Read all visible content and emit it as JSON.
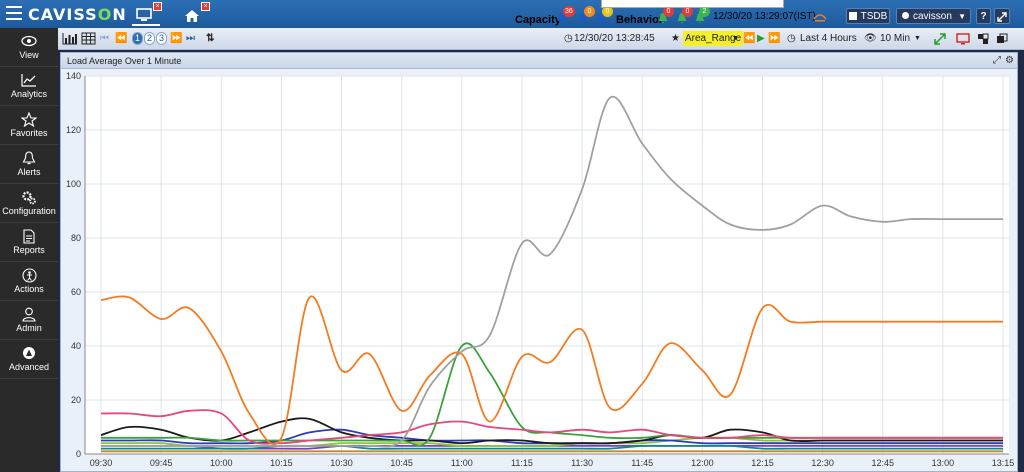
{
  "app": {
    "logo_left": "CAVISS",
    "logo_o": "O",
    "logo_right": "N"
  },
  "header": {
    "capacity_label": "Capacity",
    "capacity_badges": [
      "36",
      "0",
      "0"
    ],
    "behavior_label": "Behavior",
    "behavior_badges": [
      "0",
      "0",
      "2"
    ],
    "timestamp": "12/30/20 13:29:07(IST)",
    "tsdb_label": "TSDB",
    "user_label": "cavisson",
    "help_label": "?",
    "badge_colors": {
      "critical": "#e23b3b",
      "major": "#f08a1c",
      "minor": "#e6c417",
      "ok": "#3fb34f"
    }
  },
  "sidebar": {
    "items": [
      {
        "label": "View",
        "icon": "eye-icon"
      },
      {
        "label": "Analytics",
        "icon": "chart-line-icon"
      },
      {
        "label": "Favorites",
        "icon": "star-icon"
      },
      {
        "label": "Alerts",
        "icon": "bell-icon"
      },
      {
        "label": "Configuration",
        "icon": "cogs-icon"
      },
      {
        "label": "Reports",
        "icon": "document-icon"
      },
      {
        "label": "Actions",
        "icon": "actions-icon"
      },
      {
        "label": "Admin",
        "icon": "user-icon"
      },
      {
        "label": "Advanced",
        "icon": "advanced-icon"
      }
    ]
  },
  "toolbar": {
    "pages": [
      "1",
      "2",
      "3"
    ],
    "current_page": "1",
    "time": "12/30/20 13:28:45",
    "area_range": "Area_Range",
    "duration": "Last 4 Hours",
    "interval": "10 Min"
  },
  "panel": {
    "title": "Load Average Over 1 Minute"
  },
  "chart_data": {
    "type": "line",
    "title": "Load Average Over 1 Minute",
    "xlabel": "",
    "ylabel": "",
    "ylim": [
      0,
      140
    ],
    "yticks": [
      0,
      20,
      40,
      60,
      80,
      100,
      120,
      140
    ],
    "grid": true,
    "categories": [
      "09:30",
      "09:45",
      "10:00",
      "10:15",
      "10:30",
      "10:45",
      "11:00",
      "11:15",
      "11:30",
      "11:45",
      "12:00",
      "12:15",
      "12:30",
      "12:45",
      "13:00",
      "13:15"
    ],
    "x_minutes": [
      0,
      7,
      15,
      22,
      30,
      37,
      45,
      52,
      60,
      67,
      75,
      82,
      90,
      97,
      105,
      112,
      120,
      127,
      135,
      142,
      150,
      157,
      165,
      172,
      180,
      187,
      195,
      202,
      210,
      217,
      225
    ],
    "series": [
      {
        "color": "#a0a0a0",
        "values": [
          3,
          3,
          3,
          3,
          3,
          3,
          3,
          3,
          3,
          3,
          5,
          25,
          38,
          44,
          78,
          74,
          98,
          132,
          115,
          102,
          92,
          85,
          83,
          85,
          92,
          88,
          86,
          87,
          87,
          87,
          87
        ]
      },
      {
        "color": "#f47b20",
        "values": [
          57,
          58,
          50,
          54,
          38,
          15,
          6,
          58,
          31,
          37,
          16,
          29,
          37,
          12,
          36,
          34,
          46,
          17,
          26,
          41,
          31,
          22,
          54,
          49,
          49,
          49,
          49,
          49,
          49,
          49,
          49
        ]
      },
      {
        "color": "#e8467c",
        "values": [
          15,
          15,
          14,
          16,
          15,
          5,
          4,
          5,
          6,
          7,
          8,
          11,
          12,
          10,
          9,
          8,
          9,
          8,
          9,
          7,
          6,
          6,
          7,
          6,
          6,
          6,
          6,
          6,
          6,
          6,
          6
        ]
      },
      {
        "color": "#3aa23a",
        "values": [
          6,
          6,
          6,
          6,
          5,
          5,
          5,
          5,
          5,
          5,
          5,
          6,
          40,
          30,
          10,
          8,
          7,
          6,
          6,
          7,
          6,
          6,
          6,
          6,
          6,
          6,
          6,
          6,
          6,
          6,
          6
        ]
      },
      {
        "color": "#1a1a1a",
        "values": [
          7,
          10,
          9,
          6,
          5,
          8,
          12,
          13,
          8,
          6,
          5,
          5,
          4,
          5,
          5,
          4,
          4,
          4,
          5,
          7,
          6,
          9,
          8,
          5,
          5,
          5,
          5,
          5,
          5,
          5,
          5
        ]
      },
      {
        "color": "#2b3bbd",
        "values": [
          5,
          5,
          5,
          4,
          4,
          4,
          5,
          8,
          9,
          7,
          6,
          5,
          5,
          5,
          4,
          4,
          4,
          4,
          5,
          5,
          4,
          4,
          4,
          4,
          4,
          4,
          4,
          4,
          4,
          4,
          4
        ]
      },
      {
        "color": "#8fc43a",
        "values": [
          4,
          4,
          4,
          3,
          3,
          3,
          3,
          3,
          4,
          4,
          4,
          4,
          3,
          3,
          3,
          3,
          4,
          4,
          4,
          5,
          6,
          6,
          5,
          5,
          5,
          5,
          5,
          5,
          5,
          5,
          5
        ]
      },
      {
        "color": "#0c8b8b",
        "values": [
          2,
          2,
          2,
          2,
          2,
          2,
          3,
          3,
          3,
          2,
          2,
          2,
          2,
          2,
          2,
          2,
          2,
          2,
          3,
          3,
          3,
          3,
          2,
          2,
          2,
          2,
          2,
          2,
          2,
          2,
          2
        ]
      },
      {
        "color": "#7b3fbf",
        "values": [
          3,
          3,
          3,
          3,
          2,
          2,
          2,
          2,
          3,
          3,
          3,
          3,
          3,
          3,
          3,
          3,
          3,
          3,
          3,
          3,
          3,
          3,
          3,
          3,
          3,
          3,
          3,
          3,
          3,
          3,
          3
        ]
      },
      {
        "color": "#c08a2a",
        "values": [
          1,
          1,
          1,
          1,
          1,
          1,
          1,
          1,
          1,
          1,
          1,
          1,
          1,
          1,
          1,
          1,
          1,
          1,
          1,
          1,
          1,
          1,
          1,
          1,
          1,
          1,
          1,
          1,
          1,
          1,
          1
        ]
      }
    ]
  }
}
